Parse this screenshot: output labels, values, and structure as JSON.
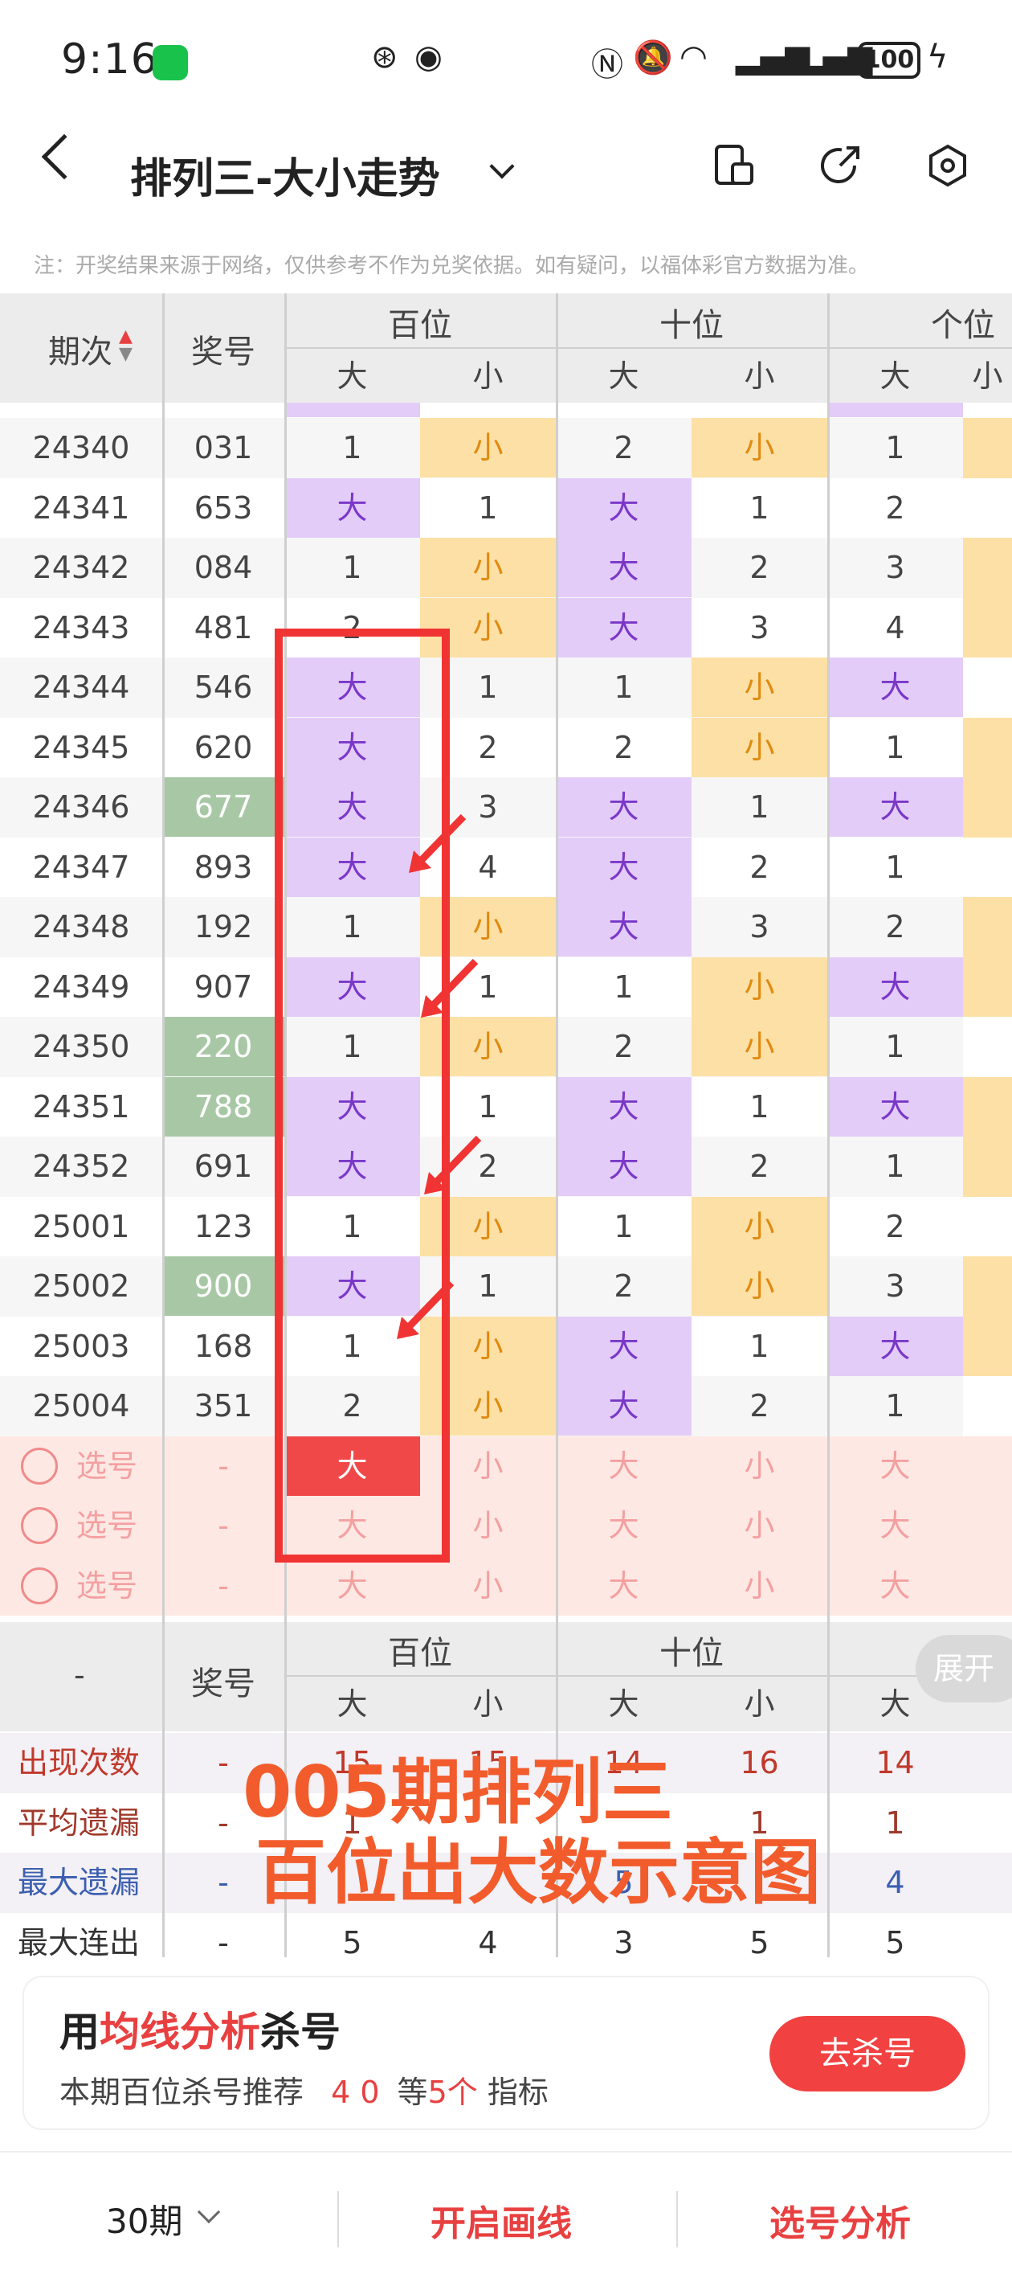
{
  "status": {
    "time": "9:16",
    "battery": "100"
  },
  "nav": {
    "title": "排列三-大小走势"
  },
  "note": "注：开奖结果来源于网络，仅供参考不作为兑奖依据。如有疑问，以福体彩官方数据为准。",
  "table": {
    "col_period": "期次",
    "col_number": "奖号",
    "groups": [
      "百位",
      "十位",
      "个位"
    ],
    "big": "大",
    "small": "小",
    "rows": [
      {
        "p": "24340",
        "n": "031",
        "c": [
          "1",
          "小",
          "2",
          "小",
          "1"
        ]
      },
      {
        "p": "24341",
        "n": "653",
        "c": [
          "大",
          "1",
          "大",
          "1",
          "2"
        ]
      },
      {
        "p": "24342",
        "n": "084",
        "c": [
          "1",
          "小",
          "大",
          "2",
          "3"
        ]
      },
      {
        "p": "24343",
        "n": "481",
        "c": [
          "2",
          "小",
          "大",
          "3",
          "4"
        ]
      },
      {
        "p": "24344",
        "n": "546",
        "c": [
          "大",
          "1",
          "1",
          "小",
          "大"
        ]
      },
      {
        "p": "24345",
        "n": "620",
        "c": [
          "大",
          "2",
          "2",
          "小",
          "1"
        ]
      },
      {
        "p": "24346",
        "n": "677",
        "c": [
          "大",
          "3",
          "大",
          "1",
          "大"
        ],
        "g": true
      },
      {
        "p": "24347",
        "n": "893",
        "c": [
          "大",
          "4",
          "大",
          "2",
          "1"
        ]
      },
      {
        "p": "24348",
        "n": "192",
        "c": [
          "1",
          "小",
          "大",
          "3",
          "2"
        ]
      },
      {
        "p": "24349",
        "n": "907",
        "c": [
          "大",
          "1",
          "1",
          "小",
          "大"
        ]
      },
      {
        "p": "24350",
        "n": "220",
        "c": [
          "1",
          "小",
          "2",
          "小",
          "1"
        ],
        "g": true
      },
      {
        "p": "24351",
        "n": "788",
        "c": [
          "大",
          "1",
          "大",
          "1",
          "大"
        ],
        "g": true
      },
      {
        "p": "24352",
        "n": "691",
        "c": [
          "大",
          "2",
          "大",
          "2",
          "1"
        ]
      },
      {
        "p": "25001",
        "n": "123",
        "c": [
          "1",
          "小",
          "1",
          "小",
          "2"
        ]
      },
      {
        "p": "25002",
        "n": "900",
        "c": [
          "大",
          "1",
          "2",
          "小",
          "3"
        ],
        "g": true
      },
      {
        "p": "25003",
        "n": "168",
        "c": [
          "1",
          "小",
          "大",
          "1",
          "大"
        ]
      },
      {
        "p": "25004",
        "n": "351",
        "c": [
          "2",
          "小",
          "大",
          "2",
          "1"
        ]
      }
    ],
    "pick_label": "选号",
    "dash": "-",
    "expand": "展开"
  },
  "stats": {
    "labels": [
      "出现次数",
      "平均遗漏",
      "最大遗漏",
      "最大连出"
    ],
    "rows": [
      [
        "15",
        "15",
        "14",
        "16",
        "14"
      ],
      [
        "1",
        "",
        "",
        "1",
        "1"
      ],
      [
        "",
        "",
        "5",
        "",
        "4"
      ],
      [
        "5",
        "4",
        "3",
        "5",
        "5"
      ]
    ]
  },
  "overlay": {
    "line1": "005期排列三",
    "line2": "百位出大数示意图"
  },
  "card": {
    "title_a": "用",
    "title_b": "均线分析",
    "title_c": "杀号",
    "sub_a": "本期百位杀号推荐",
    "sub_nums": "4 0",
    "sub_b": "等",
    "sub_count": "5个",
    "sub_c": "指标",
    "button": "去杀号"
  },
  "bottom": {
    "period": "30期",
    "draw": "开启画线",
    "analysis": "选号分析"
  }
}
